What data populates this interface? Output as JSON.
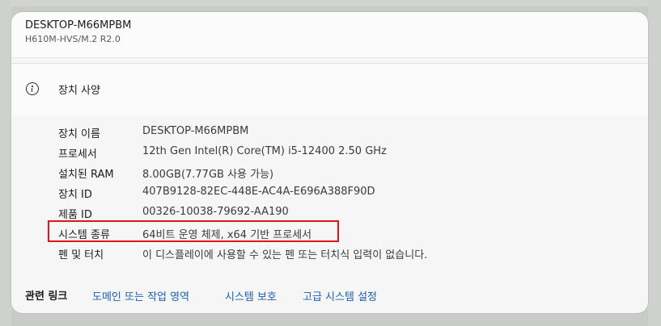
{
  "header": {
    "device_name": "DESKTOP-M66MPBM",
    "model": "H610M-HVS/M.2 R2.0"
  },
  "section": {
    "title": "장치 사양"
  },
  "specs": [
    {
      "label": "장치 이름",
      "value": "DESKTOP-M66MPBM"
    },
    {
      "label": "프로세서",
      "value": "12th Gen Intel(R) Core(TM) i5-12400   2.50 GHz"
    },
    {
      "label": "설치된 RAM",
      "value": "8.00GB(7.77GB 사용 가능)"
    },
    {
      "label": "장치 ID",
      "value": "407B9128-82EC-448E-AC4A-E696A388F90D"
    },
    {
      "label": "제품 ID",
      "value": "00326-10038-79692-AA190"
    },
    {
      "label": "시스템 종류",
      "value": "64비트 운영 체제, x64 기반 프로세서"
    },
    {
      "label": "펜 및 터치",
      "value": "이 디스플레이에 사용할 수 있는 펜 또는 터치식 입력이 없습니다."
    }
  ],
  "related_links": {
    "title": "관련 링크",
    "links": [
      "도메인 또는 작업 영역",
      "시스템 보호",
      "고급 시스템 설정"
    ]
  },
  "colors": {
    "highlight": "#e01515",
    "link": "#1a5fb4"
  }
}
